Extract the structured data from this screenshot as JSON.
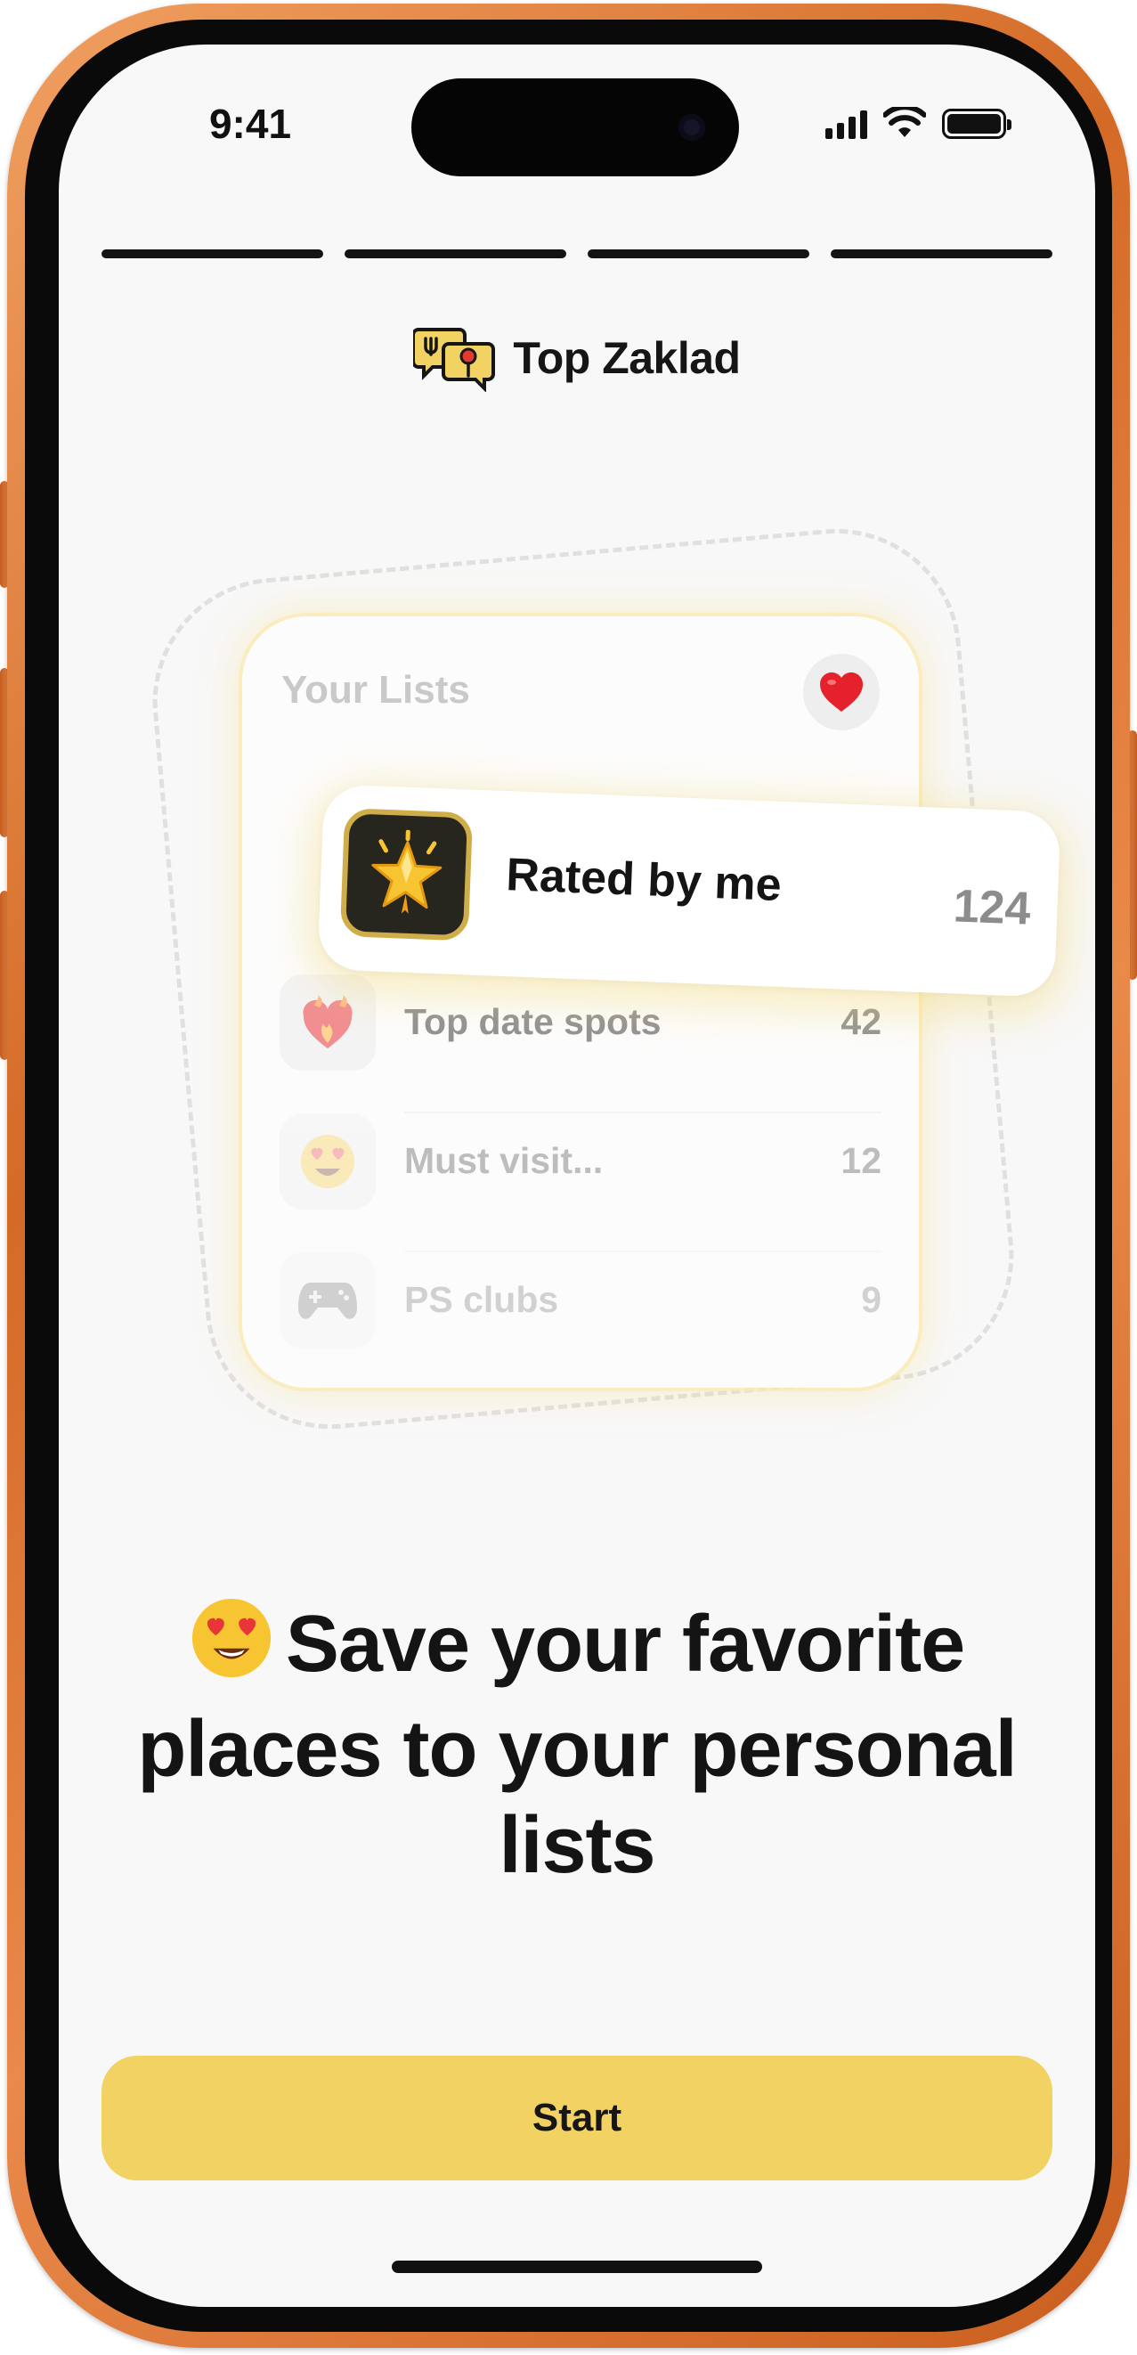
{
  "status_bar": {
    "time": "9:41",
    "signal_icon": "cellular-signal-icon",
    "wifi_icon": "wifi-icon",
    "battery_icon": "battery-icon"
  },
  "onboarding": {
    "step_count": 4,
    "current_step": 1
  },
  "brand": {
    "logo_icon": "speech-bubbles-fork-pin-icon",
    "name": "Top Zaklad"
  },
  "lists_card": {
    "title": "Your Lists",
    "favorite_icon": "red-heart-icon",
    "featured": {
      "icon": "glowing-star-icon",
      "label": "Rated by me",
      "count": "124"
    },
    "items": [
      {
        "icon": "heart-on-fire-icon",
        "label": "Top date spots",
        "count": "42"
      },
      {
        "icon": "heart-eyes-face-icon",
        "label": "Must visit...",
        "count": "12"
      },
      {
        "icon": "game-controller-icon",
        "label": "PS clubs",
        "count": "9"
      }
    ]
  },
  "headline": {
    "emoji_icon": "heart-eyes-face-icon",
    "text": "Save your favorite places to your personal lists"
  },
  "start_button": {
    "label": "Start"
  },
  "colors": {
    "accent": "#f2d263",
    "frame": "#d46a26",
    "text_primary": "#141414",
    "text_muted": "#8c8c8c"
  }
}
